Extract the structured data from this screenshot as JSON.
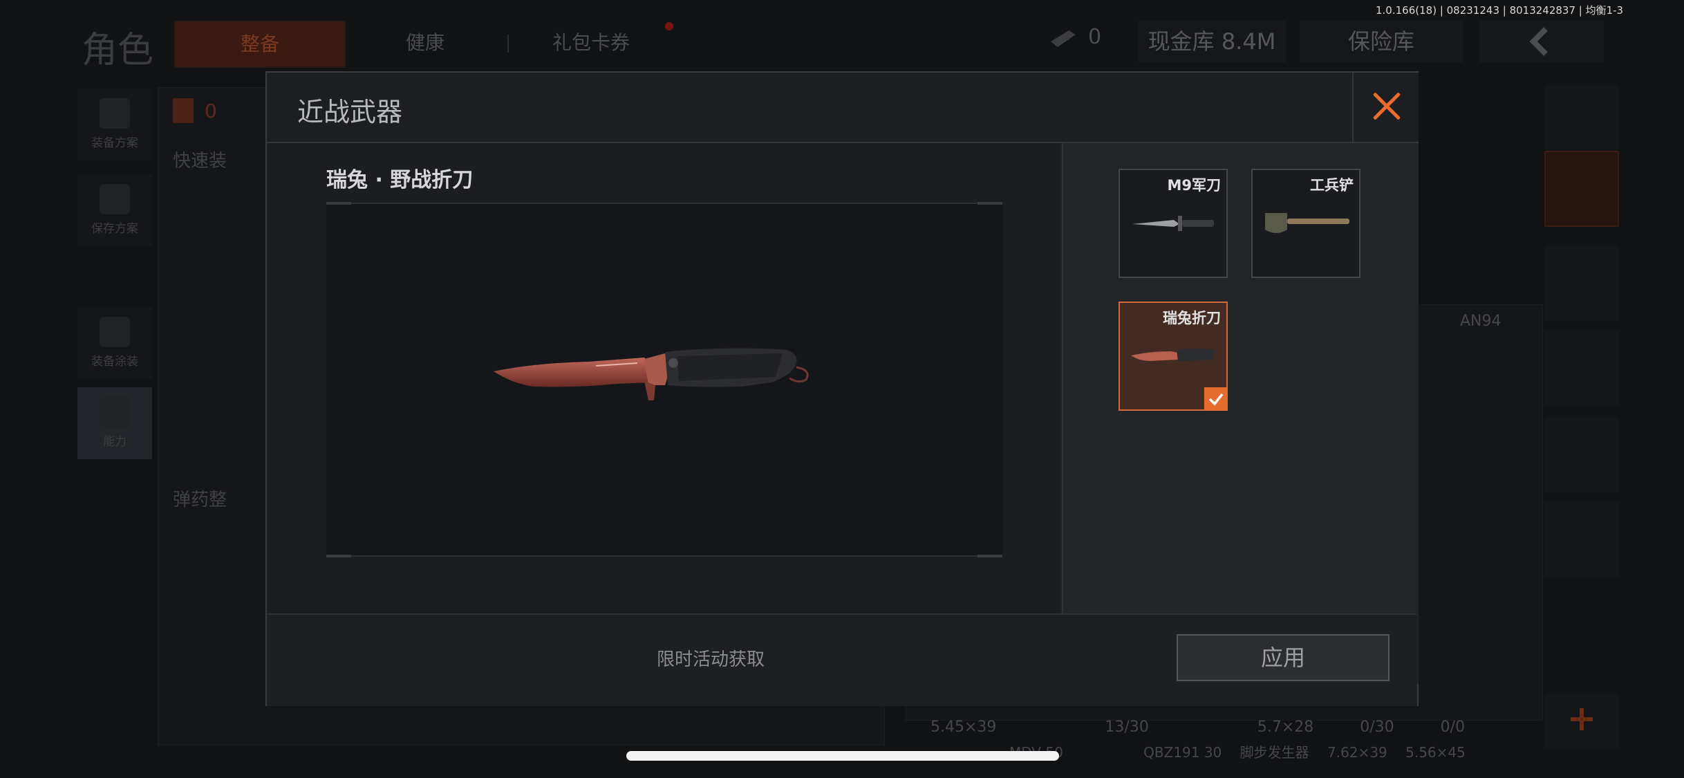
{
  "version_text": "1.0.166(18) | 08231243 | 8013242837 | 均衡1-3",
  "background": {
    "page_title": "角色",
    "tabs": [
      {
        "label": "整备",
        "active": true
      },
      {
        "label": "健康",
        "active": false
      },
      {
        "label": "礼包卡券",
        "active": false
      }
    ],
    "currency_count": "0",
    "cash_label": "现金库 8.4M",
    "vault_label": "保险库",
    "left_rail": [
      {
        "label": "装备方案",
        "icon": "vest-icon"
      },
      {
        "label": "保存方案",
        "icon": "download-icon"
      },
      {
        "label": "装备涂装",
        "icon": "helmet-icon"
      },
      {
        "label": "能力",
        "icon": "lightning-icon"
      }
    ],
    "toolbar_count": "0",
    "quick_label": "快速装",
    "ammo_label": "弹药整",
    "weapon_name": "AN94",
    "stats_row": [
      "5.45×39",
      "13/30",
      "5.7×28",
      "0/30",
      "0/0"
    ],
    "stats_row2": [
      "MDV 50",
      "QBZ191 30",
      "脚步发生器",
      "7.62×39",
      "5.56×45"
    ]
  },
  "modal": {
    "title": "近战武器",
    "selected_skin_name": "瑞兔 · 野战折刀",
    "source_text": "限时活动获取",
    "apply_label": "应用",
    "weapons": [
      {
        "label": "M9军刀",
        "icon": "bayonet-icon",
        "selected": false
      },
      {
        "label": "工兵铲",
        "icon": "shovel-icon",
        "selected": false
      },
      {
        "label": "瑞兔折刀",
        "icon": "folding-knife-icon",
        "selected": true
      }
    ]
  },
  "colors": {
    "accent": "#e56d2d",
    "modal_bg": "#202125",
    "text_primary": "#d6d7da"
  }
}
